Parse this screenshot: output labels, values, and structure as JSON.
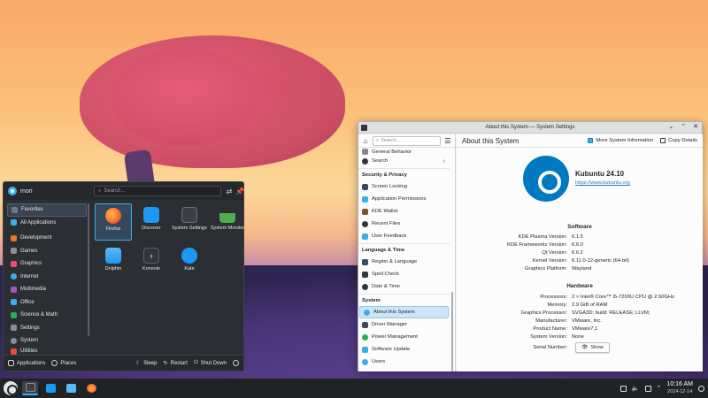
{
  "launcher": {
    "username": "mori",
    "search_placeholder": "Search...",
    "categories": [
      {
        "label": "Favorites",
        "icon": "favorites-icon",
        "color": "#6d7a86"
      },
      {
        "label": "All Applications",
        "icon": "grid-icon",
        "color": "#3daee9"
      },
      {
        "label": "Development",
        "icon": "development-icon",
        "color": "#e8762c"
      },
      {
        "label": "Games",
        "icon": "games-icon",
        "color": "#8a8f94"
      },
      {
        "label": "Graphics",
        "icon": "graphics-icon",
        "color": "#e94d78"
      },
      {
        "label": "Internet",
        "icon": "internet-icon",
        "color": "#3daee9"
      },
      {
        "label": "Multimedia",
        "icon": "multimedia-icon",
        "color": "#9b59b6"
      },
      {
        "label": "Office",
        "icon": "office-icon",
        "color": "#3daee9"
      },
      {
        "label": "Science & Math",
        "icon": "science-icon",
        "color": "#27ae60"
      },
      {
        "label": "Settings",
        "icon": "settings-icon",
        "color": "#8a8f94"
      },
      {
        "label": "System",
        "icon": "system-icon",
        "color": "#8a8f94"
      },
      {
        "label": "Utilities",
        "icon": "utilities-icon",
        "color": "#e74c3c"
      }
    ],
    "apps": [
      {
        "label": "Firefox",
        "icon": "firefox-icon",
        "color": "#ff6f2a"
      },
      {
        "label": "Discover",
        "icon": "discover-icon",
        "color": "#1d99f3"
      },
      {
        "label": "System Settings",
        "icon": "system-settings-icon",
        "color": "#3b4045"
      },
      {
        "label": "System Monitor",
        "icon": "system-monitor-icon",
        "color": "#4caf50"
      },
      {
        "label": "Dolphin",
        "icon": "dolphin-icon",
        "color": "#1d99f3"
      },
      {
        "label": "Konsole",
        "icon": "konsole-icon",
        "color": "#31363b"
      },
      {
        "label": "Kate",
        "icon": "kate-icon",
        "color": "#1d99f3"
      }
    ],
    "bottom": {
      "applications": "Applications",
      "places": "Places",
      "sleep": "Sleep",
      "restart": "Restart",
      "shutdown": "Shut Down"
    }
  },
  "window": {
    "title": "About this System — System Settings",
    "search_placeholder": "Search...",
    "page_title": "About this System",
    "more_info": "More System Information",
    "copy_details": "Copy Details",
    "sidebar": {
      "partial": "General Behavior",
      "search": "Search",
      "sec1": "Security & Privacy",
      "items1": [
        "Screen Locking",
        "Application Permissions",
        "KDE Wallet",
        "Recent Files",
        "User Feedback"
      ],
      "sec2": "Language & Time",
      "items2": [
        "Region & Language",
        "Spell Check",
        "Date & Time"
      ],
      "sec3": "System",
      "items3": [
        "About this System",
        "Driver Manager",
        "Power Management",
        "Software Update",
        "Users"
      ]
    },
    "distro": {
      "name": "Kubuntu 24.10",
      "url": "https://www.kubuntu.org"
    },
    "software": {
      "header": "Software",
      "rows": [
        {
          "k": "KDE Plasma Version:",
          "v": "6.1.5"
        },
        {
          "k": "KDE Frameworks Version:",
          "v": "6.6.0"
        },
        {
          "k": "Qt Version:",
          "v": "6.6.2"
        },
        {
          "k": "Kernel Version:",
          "v": "6.11.0-12-generic (64-bit)"
        },
        {
          "k": "Graphics Platform:",
          "v": "Wayland"
        }
      ]
    },
    "hardware": {
      "header": "Hardware",
      "rows": [
        {
          "k": "Processors:",
          "v": "2 × Intel® Core™ i5-7200U CPU @ 2.50GHz"
        },
        {
          "k": "Memory:",
          "v": "2.9 GiB of RAM"
        },
        {
          "k": "Graphics Processor:",
          "v": "SVGA3D; build: RELEASE; LLVM;"
        },
        {
          "k": "Manufacturer:",
          "v": "VMware, Inc."
        },
        {
          "k": "Product Name:",
          "v": "VMware7,1"
        },
        {
          "k": "System Version:",
          "v": "None"
        }
      ],
      "serial_label": "Serial Number:",
      "show_button": "Show"
    }
  },
  "taskbar": {
    "time": "10:16 AM",
    "date": "2024-12-14"
  },
  "colors": {
    "accent": "#3daee9",
    "kubuntu_blue": "#0079c1"
  }
}
